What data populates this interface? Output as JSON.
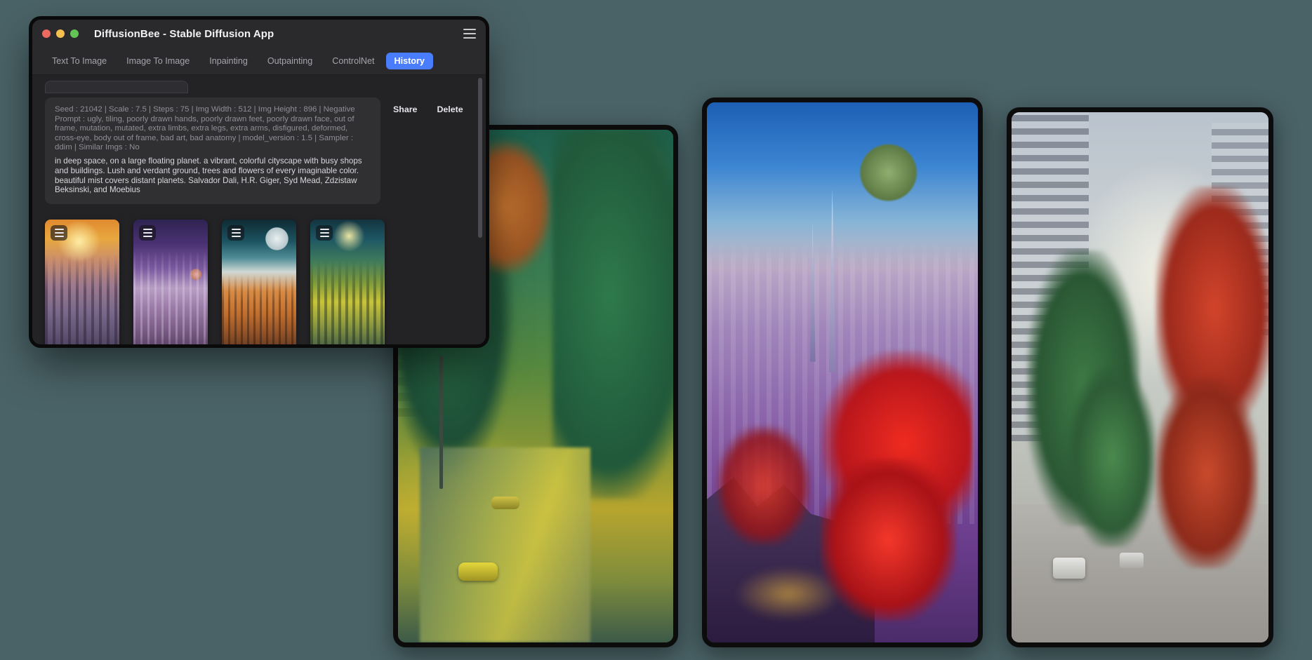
{
  "window": {
    "title": "DiffusionBee - Stable Diffusion App",
    "traffic_lights": {
      "close_label": "close",
      "minimize_label": "minimize",
      "zoom_label": "zoom"
    },
    "menu_icon": "hamburger-menu-icon"
  },
  "tabs": [
    {
      "label": "Text To Image",
      "active": false
    },
    {
      "label": "Image To Image",
      "active": false
    },
    {
      "label": "Inpainting",
      "active": false
    },
    {
      "label": "Outpainting",
      "active": false
    },
    {
      "label": "ControlNet",
      "active": false
    },
    {
      "label": "History",
      "active": true
    }
  ],
  "history_entry": {
    "metadata_text": "Seed : 21042 | Scale : 7.5 | Steps : 75 | Img Width : 512 | Img Height : 896 | Negative Prompt : ugly, tiling, poorly drawn hands, poorly drawn feet, poorly drawn face, out of frame, mutation, mutated, extra limbs, extra legs, extra arms, disfigured, deformed, cross-eye, body out of frame, bad art, bad anatomy | model_version : 1.5 | Sampler : ddim | Similar Imgs : No",
    "metadata_fields": {
      "seed": "21042",
      "scale": "7.5",
      "steps": "75",
      "img_width": "512",
      "img_height": "896",
      "negative_prompt": "ugly, tiling, poorly drawn hands, poorly drawn feet, poorly drawn face, out of frame, mutation, mutated, extra limbs, extra legs, extra arms, disfigured, deformed, cross-eye, body out of frame, bad art, bad anatomy",
      "model_version": "1.5",
      "sampler": "ddim",
      "similar_imgs": "No"
    },
    "prompt_text": "in deep space, on a large floating planet. a vibrant, colorful cityscape with busy shops and buildings. Lush and verdant ground, trees and flowers of every imaginable color. beautiful mist covers distant planets. Salvador Dali, H.R. Giger, Syd Mead, Zdzistaw Beksinski, and Moebius",
    "actions": {
      "share_label": "Share",
      "delete_label": "Delete"
    },
    "thumbnails": [
      {
        "name": "thumbnail-1",
        "alt": "golden sunset spires cityscape",
        "menu_icon": "thumbnail-menu-icon"
      },
      {
        "name": "thumbnail-2",
        "alt": "purple violet alien spire city",
        "menu_icon": "thumbnail-menu-icon"
      },
      {
        "name": "thumbnail-3",
        "alt": "orange megacity under large moon",
        "menu_icon": "thumbnail-menu-icon"
      },
      {
        "name": "thumbnail-4",
        "alt": "green yellow verdant city street",
        "menu_icon": "thumbnail-menu-icon"
      }
    ]
  },
  "generated_images": [
    {
      "name": "generated-image-green-street",
      "alt": "green and yellow city street with autumn trees and cars"
    },
    {
      "name": "generated-image-purple-megacity",
      "alt": "purple cyberpunk megacity with red trees and a planet in the sky"
    },
    {
      "name": "generated-image-misty-boulevard",
      "alt": "misty boulevard lined with green and red trees and tall buildings"
    }
  ],
  "colors": {
    "accent": "#4a7dfc",
    "window_bg": "#232326",
    "titlebar_bg": "#2a2a2d",
    "meta_box_bg": "#303033",
    "desktop_bg": "#4a6367",
    "text_primary": "#f2f2f4",
    "text_muted": "#8e8e95"
  }
}
